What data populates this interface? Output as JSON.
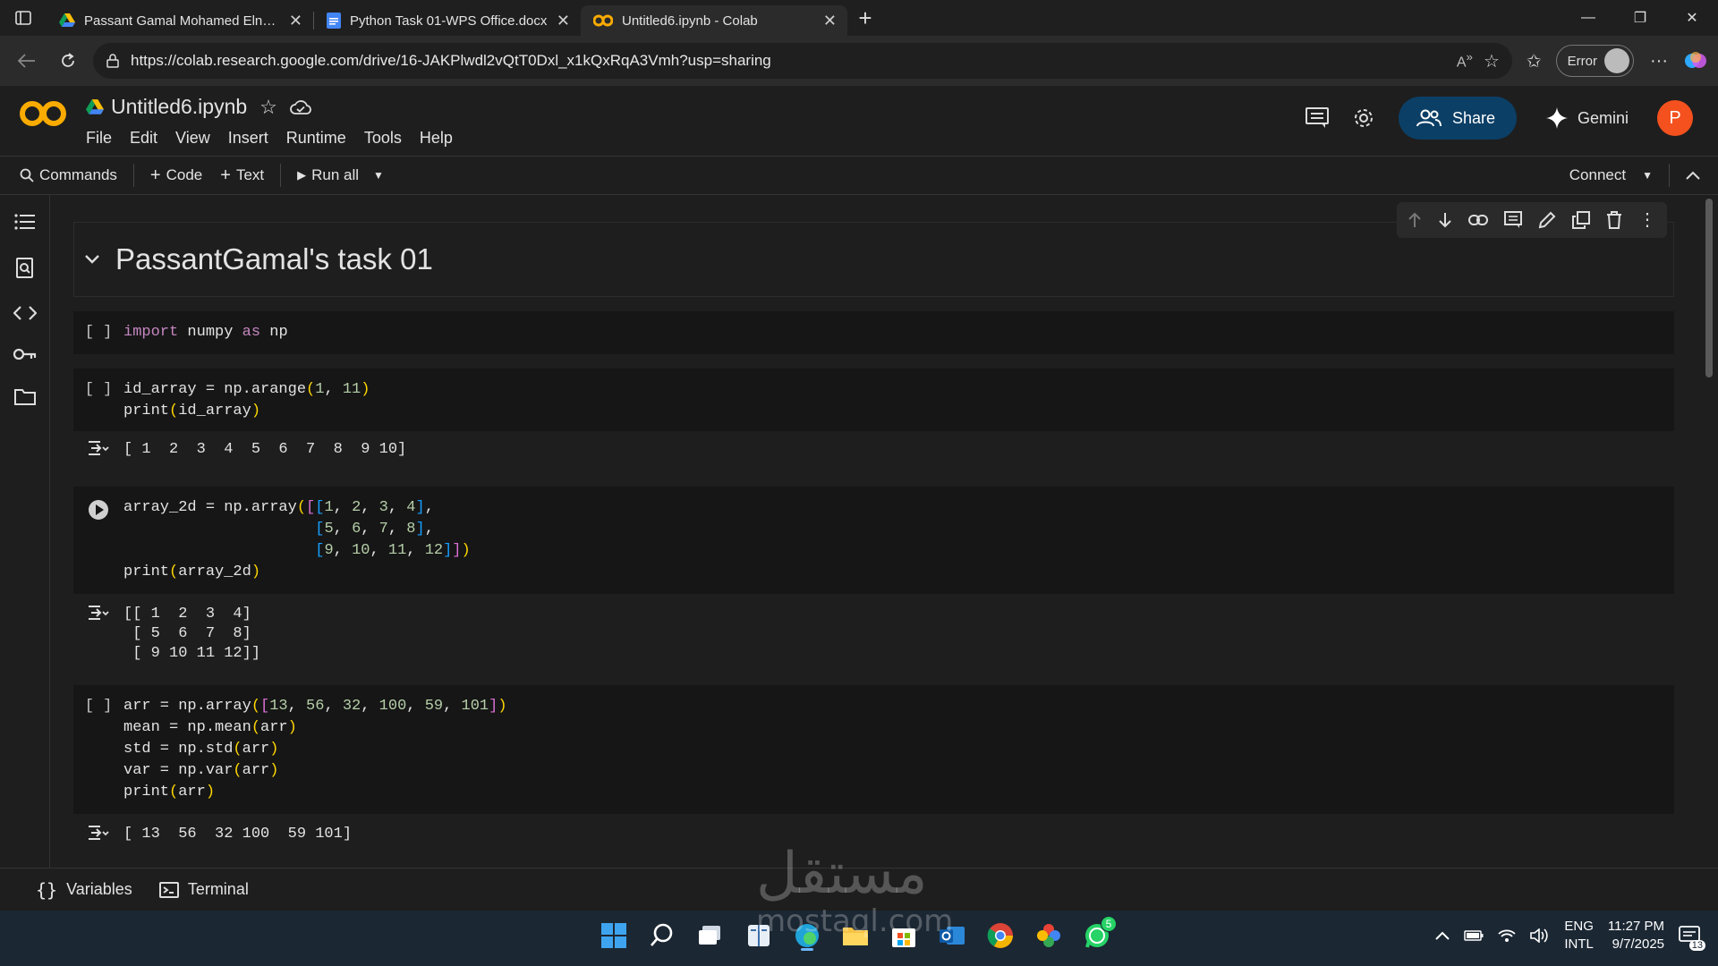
{
  "browser": {
    "tabs": [
      {
        "title": "Passant Gamal Mohamed Elneweh",
        "icon": "google-drive-icon",
        "active": false
      },
      {
        "title": "Python Task 01-WPS Office.docx",
        "icon": "docs-icon",
        "active": false
      },
      {
        "title": "Untitled6.ipynb - Colab",
        "icon": "colab-icon",
        "active": true
      }
    ],
    "url": "https://colab.research.google.com/drive/16-JAKPlwdl2vQtT0Dxl_x1kQxRqA3Vmh?usp=sharing",
    "profile_label": "Error"
  },
  "colab": {
    "notebook_title": "Untitled6.ipynb",
    "menu": [
      "File",
      "Edit",
      "View",
      "Insert",
      "Runtime",
      "Tools",
      "Help"
    ],
    "share_label": "Share",
    "gemini_label": "Gemini",
    "avatar_letter": "P",
    "toolbar": {
      "commands": "Commands",
      "code": "Code",
      "text": "Text",
      "run_all": "Run all",
      "connect": "Connect"
    }
  },
  "notebook": {
    "heading": "PassantGamal's task 01",
    "cells": [
      {
        "prompt": "[ ]",
        "code": "import numpy as np"
      },
      {
        "prompt": "[ ]",
        "code": "id_array = np.arange(1, 11)\nprint(id_array)",
        "output": "[ 1  2  3  4  5  6  7  8  9 10]"
      },
      {
        "prompt": "run",
        "code": "array_2d = np.array([[1, 2, 3, 4],\n                     [5, 6, 7, 8],\n                     [9, 10, 11, 12]])\nprint(array_2d)",
        "output": "[[ 1  2  3  4]\n [ 5  6  7  8]\n [ 9 10 11 12]]"
      },
      {
        "prompt": "[ ]",
        "code": "arr = np.array([13, 56, 32, 100, 59, 101])\nmean = np.mean(arr)\nstd = np.std(arr)\nvar = np.var(arr)\nprint(arr)",
        "output": "[ 13  56  32 100  59 101]"
      }
    ]
  },
  "bottom_bar": {
    "variables": "Variables",
    "terminal": "Terminal"
  },
  "taskbar": {
    "lang_top": "ENG",
    "lang_bottom": "INTL",
    "time": "11:27 PM",
    "date": "9/7/2025",
    "whatsapp_badge": "5",
    "notif_count": "13"
  },
  "watermark": {
    "arabic": "مستقل",
    "latin": "mostaql.com"
  }
}
